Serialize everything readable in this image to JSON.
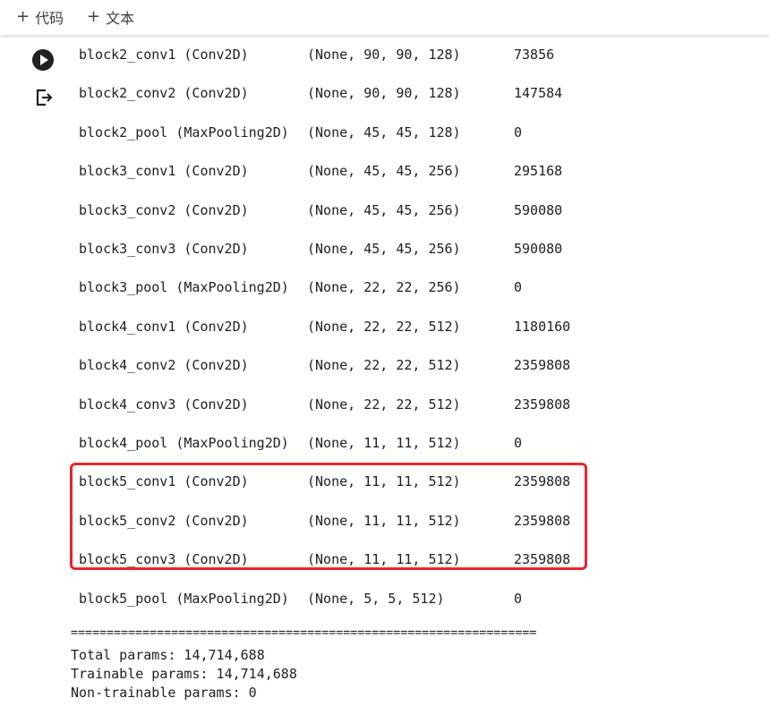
{
  "toolbar": {
    "add_code_label": "代码",
    "add_text_label": "文本",
    "plus_glyph": "+"
  },
  "layers": [
    {
      "name": "block2_conv1 (Conv2D)",
      "shape": "(None, 90, 90, 128)",
      "params": "73856"
    },
    {
      "name": "block2_conv2 (Conv2D)",
      "shape": "(None, 90, 90, 128)",
      "params": "147584"
    },
    {
      "name": "block2_pool (MaxPooling2D)",
      "shape": "(None, 45, 45, 128)",
      "params": "0"
    },
    {
      "name": "block3_conv1 (Conv2D)",
      "shape": "(None, 45, 45, 256)",
      "params": "295168"
    },
    {
      "name": "block3_conv2 (Conv2D)",
      "shape": "(None, 45, 45, 256)",
      "params": "590080"
    },
    {
      "name": "block3_conv3 (Conv2D)",
      "shape": "(None, 45, 45, 256)",
      "params": "590080"
    },
    {
      "name": "block3_pool (MaxPooling2D)",
      "shape": "(None, 22, 22, 256)",
      "params": "0"
    },
    {
      "name": "block4_conv1 (Conv2D)",
      "shape": "(None, 22, 22, 512)",
      "params": "1180160"
    },
    {
      "name": "block4_conv2 (Conv2D)",
      "shape": "(None, 22, 22, 512)",
      "params": "2359808"
    },
    {
      "name": "block4_conv3 (Conv2D)",
      "shape": "(None, 22, 22, 512)",
      "params": "2359808"
    },
    {
      "name": "block4_pool (MaxPooling2D)",
      "shape": "(None, 11, 11, 512)",
      "params": "0"
    },
    {
      "name": "block5_conv1 (Conv2D)",
      "shape": "(None, 11, 11, 512)",
      "params": "2359808"
    },
    {
      "name": "block5_conv2 (Conv2D)",
      "shape": "(None, 11, 11, 512)",
      "params": "2359808"
    },
    {
      "name": "block5_conv3 (Conv2D)",
      "shape": "(None, 11, 11, 512)",
      "params": "2359808"
    },
    {
      "name": "block5_pool (MaxPooling2D)",
      "shape": "(None, 5, 5, 512)",
      "params": "0"
    }
  ],
  "separator": "=================================================================",
  "summary": {
    "total": "Total params: 14,714,688",
    "trainable": "Trainable params: 14,714,688",
    "non_trainable": "Non-trainable params: 0"
  },
  "colors": {
    "highlight_border": "#e8262d",
    "run_button": "#212121"
  },
  "icons": {
    "run": "play-circle-icon",
    "output": "output-redirect-icon"
  }
}
